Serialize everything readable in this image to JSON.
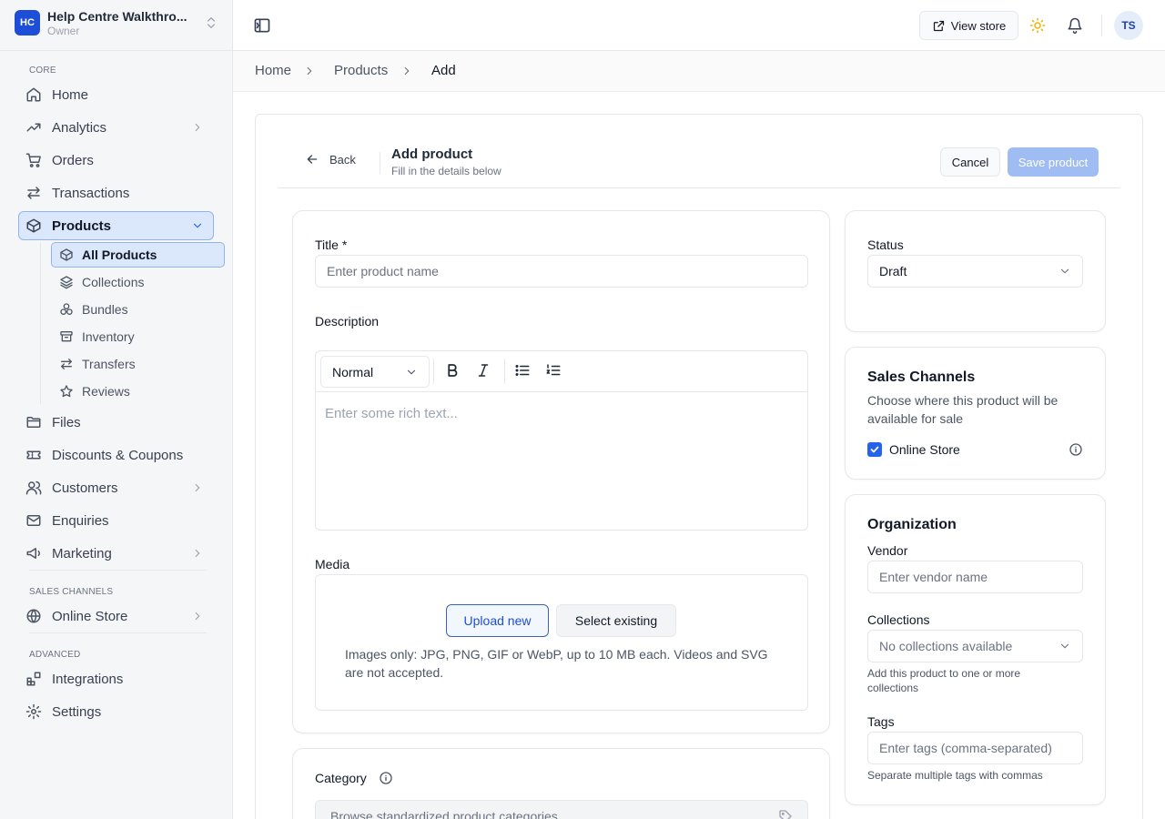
{
  "store": {
    "initials": "HC",
    "name": "Help Centre Walkthro...",
    "role": "Owner"
  },
  "sidebar": {
    "sections": [
      "CORE",
      "SALES CHANNELS",
      "ADVANCED"
    ],
    "items": [
      {
        "label": "Home",
        "icon": "home-icon"
      },
      {
        "label": "Analytics",
        "icon": "trending-up-icon"
      },
      {
        "label": "Orders",
        "icon": "cart-icon"
      },
      {
        "label": "Transactions",
        "icon": "arrows-swap-icon"
      },
      {
        "label": "Products",
        "icon": "box-icon"
      },
      {
        "label": "Files",
        "icon": "folder-icon"
      },
      {
        "label": "Discounts & Coupons",
        "icon": "ticket-icon"
      },
      {
        "label": "Customers",
        "icon": "users-icon"
      },
      {
        "label": "Enquiries",
        "icon": "mail-icon"
      },
      {
        "label": "Marketing",
        "icon": "megaphone-icon"
      },
      {
        "label": "Online Store",
        "icon": "globe-icon"
      },
      {
        "label": "Integrations",
        "icon": "blocks-icon"
      },
      {
        "label": "Settings",
        "icon": "gear-icon"
      }
    ],
    "products_sub": [
      {
        "label": "All Products",
        "icon": "box-icon"
      },
      {
        "label": "Collections",
        "icon": "layers-icon"
      },
      {
        "label": "Bundles",
        "icon": "bundle-icon"
      },
      {
        "label": "Inventory",
        "icon": "archive-icon"
      },
      {
        "label": "Transfers",
        "icon": "arrows-swap-icon"
      },
      {
        "label": "Reviews",
        "icon": "star-icon"
      }
    ]
  },
  "topbar": {
    "view_store": "View store",
    "avatar": "TS"
  },
  "breadcrumb": [
    "Home",
    "Products",
    "Add"
  ],
  "header": {
    "back": "Back",
    "title": "Add product",
    "subtitle": "Fill in the details below",
    "cancel": "Cancel",
    "save": "Save product"
  },
  "form": {
    "title_label": "Title *",
    "title_placeholder": "Enter product name",
    "description_label": "Description",
    "format": "Normal",
    "editor_placeholder": "Enter some rich text...",
    "media_label": "Media",
    "upload_new": "Upload new",
    "select_existing": "Select existing",
    "media_note": "Images only: JPG, PNG, GIF or WebP, up to 10 MB each. Videos and SVG are not accepted.",
    "category_label": "Category",
    "category_placeholder": "Browse standardized product categories"
  },
  "status": {
    "label": "Status",
    "value": "Draft"
  },
  "sales_channels": {
    "title": "Sales Channels",
    "description": "Choose where this product will be available for sale",
    "online_store": "Online Store",
    "online_store_checked": true
  },
  "organization": {
    "title": "Organization",
    "vendor_label": "Vendor",
    "vendor_placeholder": "Enter vendor name",
    "collections_label": "Collections",
    "collections_value": "No collections available",
    "collections_help": "Add this product to one or more collections",
    "tags_label": "Tags",
    "tags_placeholder": "Enter tags (comma-separated)",
    "tags_help": "Separate multiple tags with commas"
  },
  "colors": {
    "accent": "#2563eb",
    "active_nav_bg": "#dbe7fb",
    "save_disabled": "#9fbdf3"
  }
}
